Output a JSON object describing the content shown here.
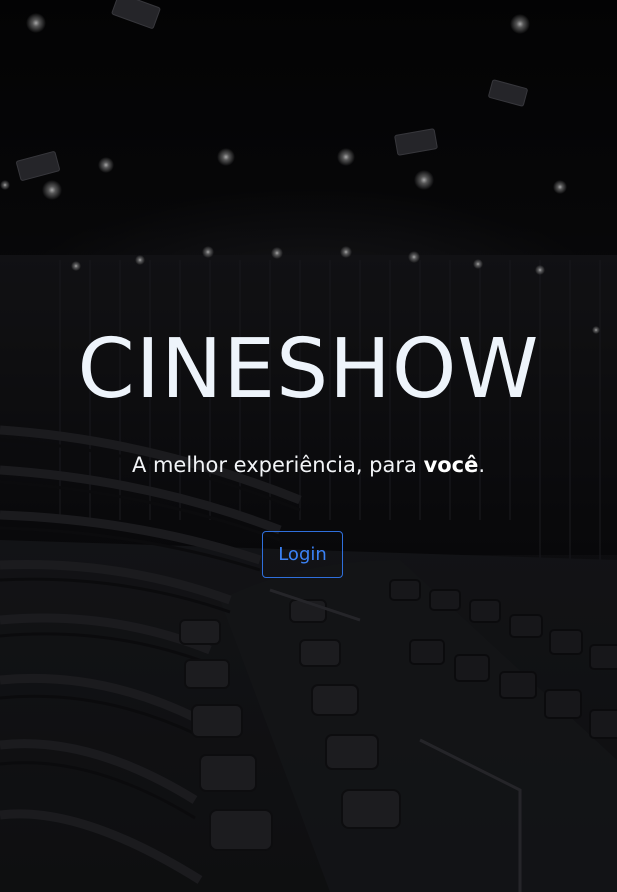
{
  "hero": {
    "title": "CINESHOW",
    "tagline_prefix": "A melhor experiência, para ",
    "tagline_emphasis": "você",
    "tagline_suffix": ".",
    "login_label": "Login",
    "background_image": "cinema-auditorium-seats"
  },
  "colors": {
    "title": "#eef4fb",
    "login_accent": "#3b82f6",
    "background": "#070708"
  }
}
